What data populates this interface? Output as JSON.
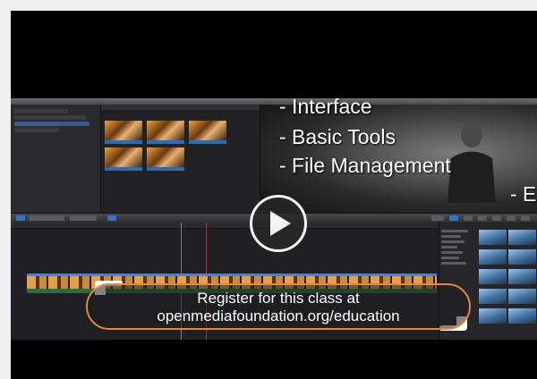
{
  "video": {
    "overlay_lines": [
      "- Interface",
      "- Basic Tools",
      "- File Management"
    ],
    "overlay_tail": "- E",
    "play_button_icon": "play-icon",
    "banner": {
      "line1": "Register for this class at",
      "line2": "openmediafoundation.org/education"
    }
  },
  "colors": {
    "banner_border": "#e08a3c",
    "playhead": "#d02a2a",
    "selection_blue": "#3b6fcf"
  }
}
